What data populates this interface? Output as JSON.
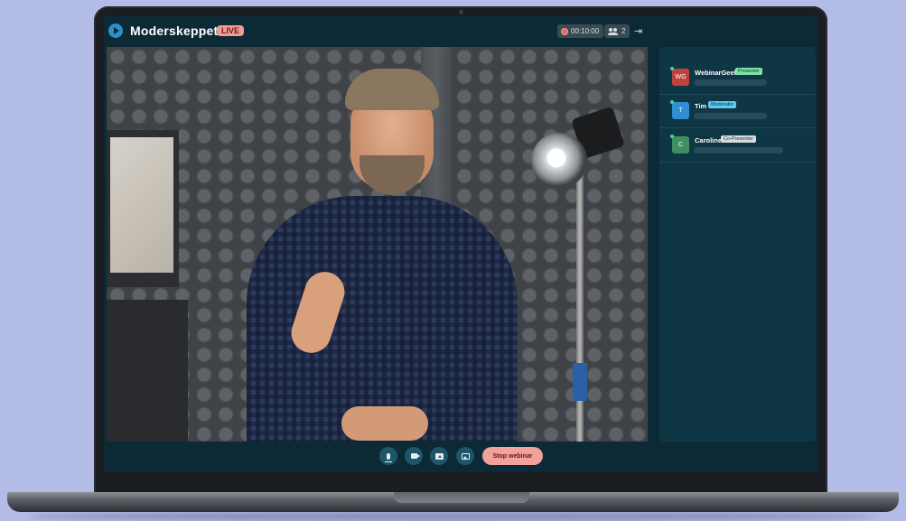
{
  "app": {
    "brand": "Moderskeppet",
    "live_label": "LIVE"
  },
  "header": {
    "timer": "00:10:00",
    "viewer_count": "2"
  },
  "participants": [
    {
      "initials": "WG",
      "name": "WebinarGeek",
      "role": "Presenter",
      "avatar_color": "#c0423f",
      "role_bg": "#7ee0a6",
      "role_fg": "#0b3a22"
    },
    {
      "initials": "T",
      "name": "Tim",
      "role": "Moderator",
      "avatar_color": "#2e8fd4",
      "role_bg": "#5ec8ef",
      "role_fg": "#06324a"
    },
    {
      "initials": "C",
      "name": "Caroline",
      "role": "Co-Presenter",
      "avatar_color": "#3f8f61",
      "role_bg": "#d5dde2",
      "role_fg": "#233038"
    }
  ],
  "controls": {
    "stop_label": "Stop webinar"
  },
  "colors": {
    "screen_bg": "#0b2a36",
    "accent": "#f2a19c",
    "page_bg": "#b3bce6"
  }
}
